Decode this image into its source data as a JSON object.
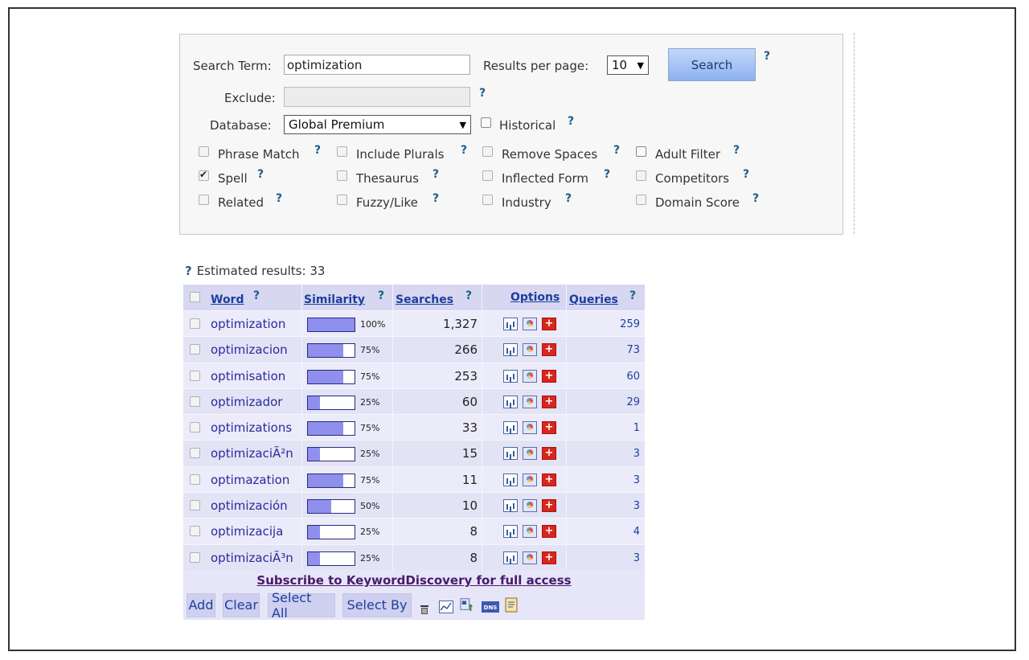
{
  "form": {
    "search_term_label": "Search Term:",
    "search_term_value": "optimization",
    "results_per_page_label": "Results per page:",
    "results_per_page_value": "10",
    "search_button": "Search",
    "exclude_label": "Exclude:",
    "exclude_value": "",
    "database_label": "Database:",
    "database_value": "Global Premium",
    "historical_label": "Historical",
    "help": "?",
    "options": [
      {
        "label": "Phrase Match",
        "checked": false
      },
      {
        "label": "Include Plurals",
        "checked": false
      },
      {
        "label": "Remove Spaces",
        "checked": false
      },
      {
        "label": "Adult Filter",
        "checked": false
      },
      {
        "label": "Spell",
        "checked": true
      },
      {
        "label": "Thesaurus",
        "checked": false
      },
      {
        "label": "Inflected Form",
        "checked": false
      },
      {
        "label": "Competitors",
        "checked": false
      },
      {
        "label": "Related",
        "checked": false
      },
      {
        "label": "Fuzzy/Like",
        "checked": false
      },
      {
        "label": "Industry",
        "checked": false
      },
      {
        "label": "Domain Score",
        "checked": false
      }
    ]
  },
  "results": {
    "estimated_label": "Estimated results: 33",
    "columns": {
      "word": "Word",
      "similarity": "Similarity",
      "searches": "Searches",
      "options": "Options",
      "queries": "Queries"
    },
    "rows": [
      {
        "word": "optimization",
        "similarity": 100,
        "similarity_label": "100%",
        "searches": "1,327",
        "queries": "259"
      },
      {
        "word": "optimizacion",
        "similarity": 75,
        "similarity_label": "75%",
        "searches": "266",
        "queries": "73"
      },
      {
        "word": "optimisation",
        "similarity": 75,
        "similarity_label": "75%",
        "searches": "253",
        "queries": "60"
      },
      {
        "word": "optimizador",
        "similarity": 25,
        "similarity_label": "25%",
        "searches": "60",
        "queries": "29"
      },
      {
        "word": "optimizations",
        "similarity": 75,
        "similarity_label": "75%",
        "searches": "33",
        "queries": "1"
      },
      {
        "word": "optimizaciÃ²n",
        "similarity": 25,
        "similarity_label": "25%",
        "searches": "15",
        "queries": "3"
      },
      {
        "word": "optimazation",
        "similarity": 75,
        "similarity_label": "75%",
        "searches": "11",
        "queries": "3"
      },
      {
        "word": "optimización",
        "similarity": 50,
        "similarity_label": "50%",
        "searches": "10",
        "queries": "3"
      },
      {
        "word": "optimizacija",
        "similarity": 25,
        "similarity_label": "25%",
        "searches": "8",
        "queries": "4"
      },
      {
        "word": "optimizaciÃ³n",
        "similarity": 25,
        "similarity_label": "25%",
        "searches": "8",
        "queries": "3"
      }
    ],
    "subscribe_link": "Subscribe to KeywordDiscovery for full access",
    "footer_buttons": {
      "add": "Add",
      "clear": "Clear",
      "select_all": "Select All",
      "select_by": "Select By"
    },
    "icons": [
      "trash-icon",
      "line-chart-icon",
      "export-icon",
      "dns-icon",
      "notes-icon"
    ]
  }
}
